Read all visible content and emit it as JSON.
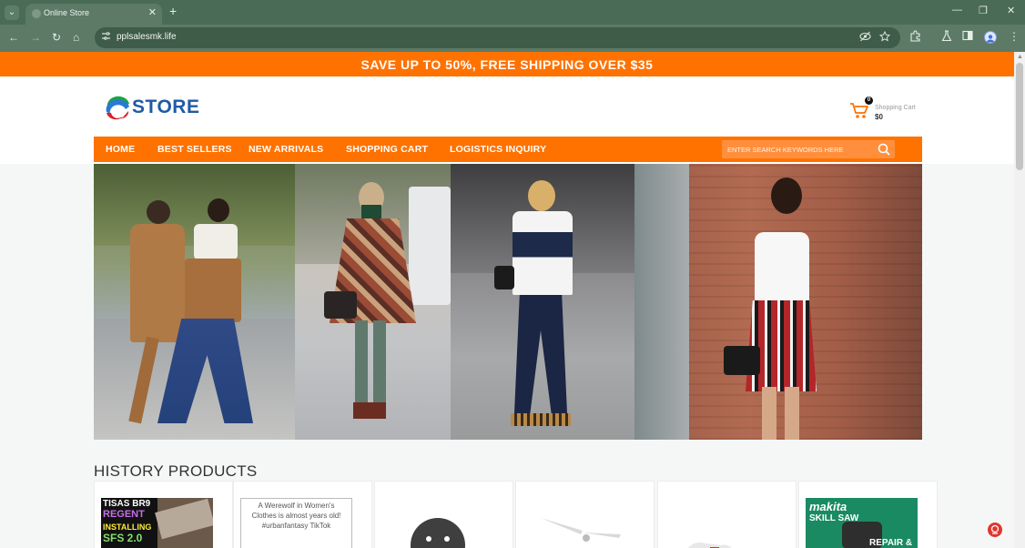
{
  "browser": {
    "tab_title": "Online Store",
    "url": "pplsalesmk.life",
    "tab_list_glyph": "⌄",
    "close_glyph": "✕",
    "new_tab_glyph": "+",
    "minimize_glyph": "—",
    "restore_glyph": "❐",
    "window_close_glyph": "✕",
    "back_glyph": "←",
    "forward_glyph": "→",
    "reload_glyph": "↻",
    "home_glyph": "⌂",
    "menu_glyph": "⋮"
  },
  "promo": {
    "text": "SAVE UP TO 50%, FREE SHIPPING OVER $35"
  },
  "logo": {
    "text": "STORE"
  },
  "cart": {
    "count": "0",
    "label": "Shopping Cart",
    "total": "$0"
  },
  "nav": {
    "items": [
      "HOME",
      "BEST SELLERS",
      "NEW ARRIVALS",
      "SHOPPING CART",
      "LOGISTICS INQUIRY"
    ],
    "search_placeholder": "ENTER SEARCH KEYWORDS HERE"
  },
  "history": {
    "title": "HISTORY PRODUCTS",
    "products": [
      {
        "thumb_text": ""
      },
      {
        "thumb_text": "A Werewolf in Women's Clothes is almost years old! #urbanfantasy TikTok"
      },
      {
        "thumb_text": ""
      },
      {
        "thumb_text": ""
      },
      {
        "thumb_text": ""
      },
      {
        "thumb_text": ""
      }
    ],
    "product1_lines": [
      "TISAS BR9",
      "REGENT",
      "INSTALLING",
      "SFS 2.0"
    ],
    "product6_lines": [
      "makita",
      "SKILL SAW",
      "REPAIR &"
    ]
  },
  "colors": {
    "accent": "#ff7200",
    "brand_blue": "#1f5aa6",
    "chrome": "#4a6b55"
  }
}
